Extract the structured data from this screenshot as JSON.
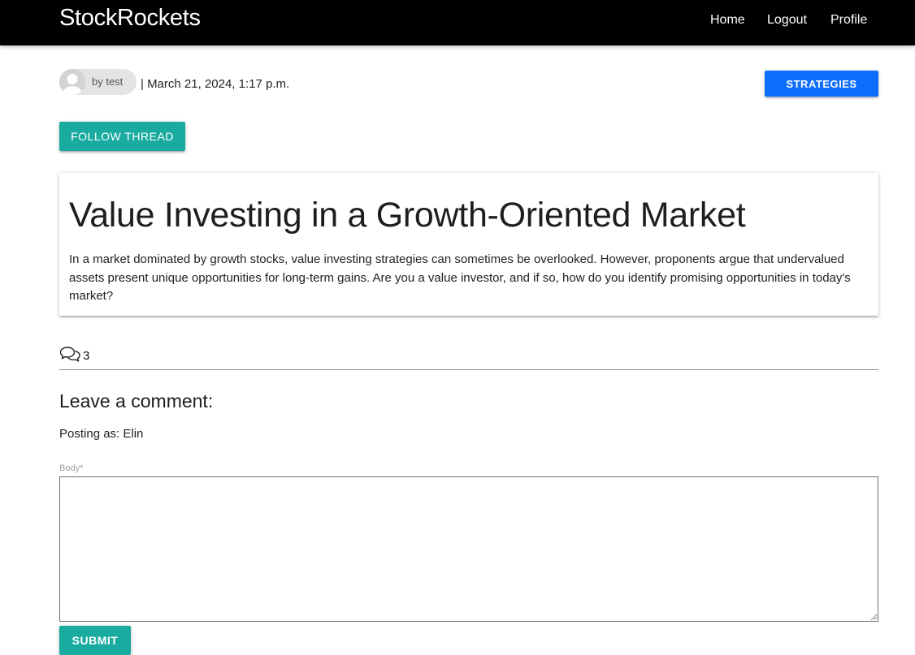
{
  "navbar": {
    "brand": "StockRockets",
    "links": [
      {
        "label": "Home"
      },
      {
        "label": "Logout"
      },
      {
        "label": "Profile"
      }
    ]
  },
  "post": {
    "author_chip": "by test",
    "date": "| March 21, 2024, 1:17 p.m.",
    "category_button": "STRATEGIES",
    "follow_button": "FOLLOW THREAD",
    "title": "Value Investing in a Growth-Oriented Market",
    "body": "In a market dominated by growth stocks, value investing strategies can sometimes be overlooked. However, proponents argue that undervalued assets present unique opportunities for long-term gains. Are you a value investor, and if so, how do you identify promising opportunities in today's market?",
    "comment_count": "3",
    "comment_icon": "comments-icon"
  },
  "comment_form": {
    "heading": "Leave a comment:",
    "posting_as": "Posting as: Elin",
    "body_label": "Body*",
    "body_value": "",
    "submit_label": "SUBMIT"
  },
  "colors": {
    "navbar_bg": "#000000",
    "primary_blue": "#0d6efd",
    "teal": "#19ab9f"
  }
}
